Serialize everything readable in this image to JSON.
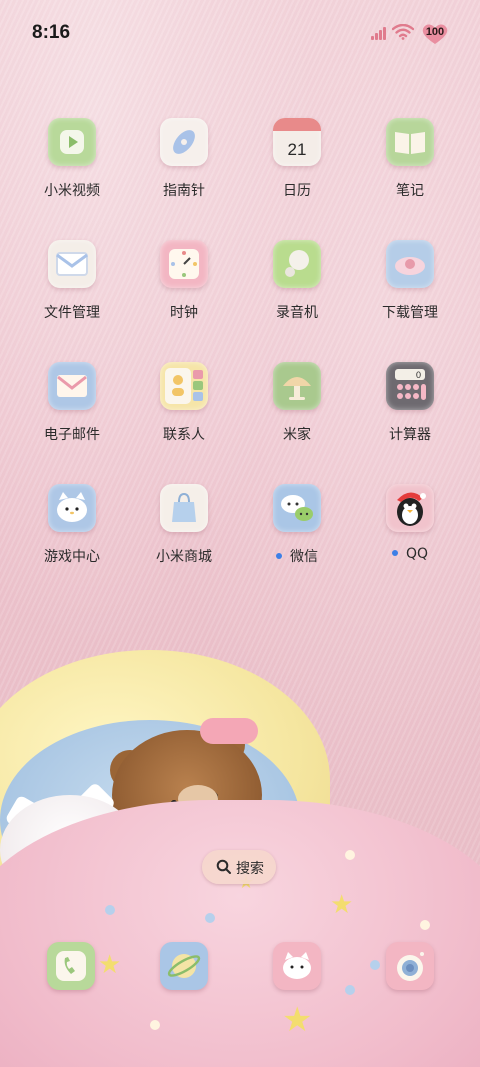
{
  "status_bar": {
    "time": "8:16",
    "battery": "100"
  },
  "apps": [
    {
      "label": "小米视频",
      "icon": "video-play-icon",
      "notify": false
    },
    {
      "label": "指南针",
      "icon": "compass-icon",
      "notify": false
    },
    {
      "label": "日历",
      "icon": "calendar-icon",
      "calendar_day": "21",
      "notify": false
    },
    {
      "label": "笔记",
      "icon": "notes-book-icon",
      "notify": false
    },
    {
      "label": "文件管理",
      "icon": "file-envelope-icon",
      "notify": false
    },
    {
      "label": "时钟",
      "icon": "clock-icon",
      "notify": false
    },
    {
      "label": "录音机",
      "icon": "recorder-icon",
      "notify": false
    },
    {
      "label": "下载管理",
      "icon": "download-cloud-icon",
      "notify": false
    },
    {
      "label": "电子邮件",
      "icon": "mail-icon",
      "notify": false
    },
    {
      "label": "联系人",
      "icon": "contacts-icon",
      "notify": false
    },
    {
      "label": "米家",
      "icon": "mushroom-lamp-icon",
      "notify": false
    },
    {
      "label": "计算器",
      "icon": "calculator-icon",
      "calculator_display": "0",
      "notify": false
    },
    {
      "label": "游戏中心",
      "icon": "cat-face-icon",
      "notify": false
    },
    {
      "label": "小米商城",
      "icon": "shopping-bag-icon",
      "notify": false
    },
    {
      "label": "微信",
      "icon": "wechat-icon",
      "notify": true
    },
    {
      "label": "QQ",
      "icon": "qq-penguin-icon",
      "notify": true
    }
  ],
  "search": {
    "label": "搜索"
  },
  "dock": [
    {
      "icon": "phone-icon"
    },
    {
      "icon": "browser-planet-icon"
    },
    {
      "icon": "messages-cat-icon"
    },
    {
      "icon": "camera-icon"
    }
  ],
  "colors": {
    "background": "#efc8d1",
    "notify_dot": "#3d7fe6",
    "signal": "#e07b8d",
    "battery_heart": "#e98ea0"
  }
}
